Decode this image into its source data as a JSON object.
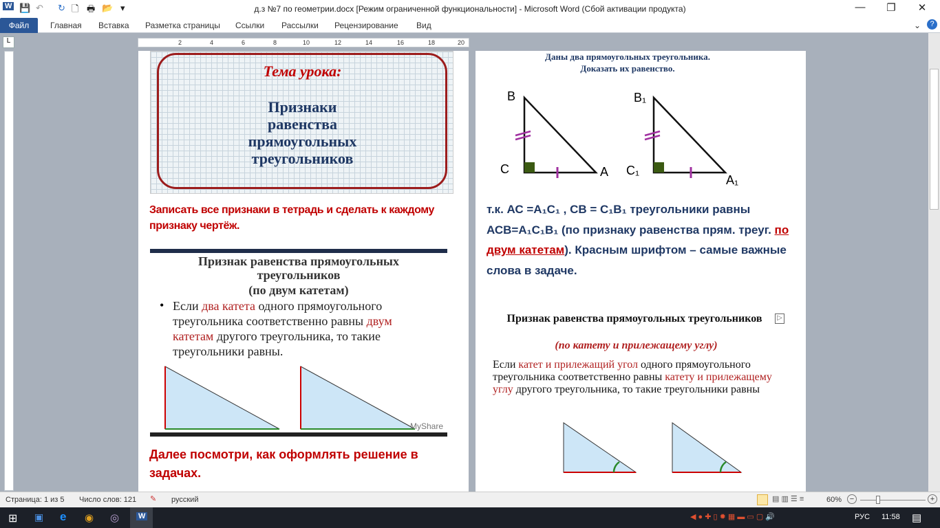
{
  "window": {
    "title": "д.з №7 по геометрии.docx [Режим ограниченной функциональности]  -  Microsoft Word (Сбой активации продукта)",
    "minimize": "—",
    "restore": "❐",
    "close": "✕"
  },
  "quick_access": {
    "app_icon": "W",
    "save": "💾",
    "undo": "↶",
    "redo": "↻",
    "new": "🗋",
    "print": "🖶",
    "open": "📂",
    "customize": "▾"
  },
  "ribbon": {
    "tabs": [
      "Файл",
      "Главная",
      "Вставка",
      "Разметка страницы",
      "Ссылки",
      "Рассылки",
      "Рецензирование",
      "Вид"
    ],
    "collapse": "⌄",
    "help": "?"
  },
  "ruler": {
    "labels": [
      "2",
      "4",
      "6",
      "8",
      "10",
      "12",
      "14",
      "16",
      "18",
      "20"
    ],
    "tab_selector": "L"
  },
  "left_page": {
    "slide1": {
      "title": "Тема урока:",
      "body": [
        "Признаки",
        "равенства",
        "прямоугольных",
        "треугольников"
      ]
    },
    "instruction": "Записать все признаки в тетрадь и сделать к каждому признаку  чертёж.",
    "slide2": {
      "title": "Признак равенства прямоугольных треугольников",
      "subtitle": "(по двум катетам)",
      "bullet": [
        {
          "t": "Если ",
          "c": "k"
        },
        {
          "t": "два катета",
          "c": "r"
        },
        {
          "t": " одного прямоугольного  треугольника соответственно равны ",
          "c": "k"
        },
        {
          "t": "двум катетам",
          "c": "r"
        },
        {
          "t": " другого треугольника,  то такие треугольники равны.",
          "c": "k"
        }
      ],
      "watermark": "MyShare"
    },
    "next": "Далее посмотри, как оформлять решение в задачах."
  },
  "right_page": {
    "task": [
      "Даны два прямоугольных треугольника.",
      "Доказать их равенство."
    ],
    "fig1": {
      "B": "B",
      "C": "C",
      "A": "A"
    },
    "fig2": {
      "B": "B₁",
      "C": "C₁",
      "A": "A₁"
    },
    "solution": [
      {
        "t": " т.к. АС =А₁С₁ , СВ = С₁В₁  треугольники равны АСВ=А₁С₁В₁ (по признаку равенства прям. треуг. ",
        "c": "n"
      },
      {
        "t": "по двум катетам",
        "c": "r"
      },
      {
        "t": "). Красным шрифтом – самые важные слова в задаче.",
        "c": "n"
      }
    ],
    "slide3": {
      "title": "Признак равенства прямоугольных треугольников",
      "subtitle": "(по катету и прилежащему углу)",
      "body": [
        {
          "t": "Если ",
          "c": "k"
        },
        {
          "t": "катет и прилежащий угол",
          "c": "r"
        },
        {
          "t": " одного прямоугольного треугольника соответственно равны ",
          "c": "k"
        },
        {
          "t": "катету и прилежащему углу",
          "c": "r"
        },
        {
          "t": "  другого треугольника, то  такие треугольники равны",
          "c": "k"
        }
      ]
    }
  },
  "status": {
    "page": "Страница: 1 из 5",
    "words": "Число слов: 121",
    "language": "русский",
    "zoom": "60%",
    "zoom_level": 60
  },
  "taskbar": {
    "lang": "РУС",
    "time": "11:58"
  }
}
